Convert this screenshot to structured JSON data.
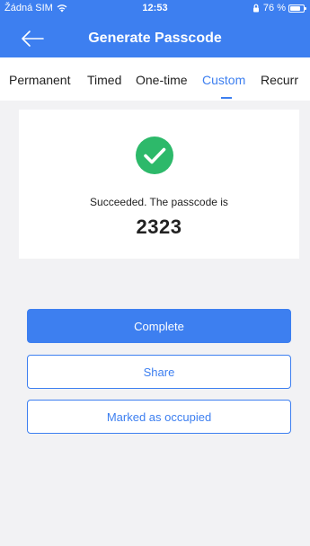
{
  "status_bar": {
    "carrier": "Žádná SIM",
    "time": "12:53",
    "battery": "76 %"
  },
  "nav": {
    "title": "Generate Passcode",
    "back_icon": "arrow-left-icon"
  },
  "tabs": [
    {
      "label": "Permanent",
      "active": false
    },
    {
      "label": "Timed",
      "active": false
    },
    {
      "label": "One-time",
      "active": false
    },
    {
      "label": "Custom",
      "active": true
    },
    {
      "label": "Recurr",
      "active": false
    }
  ],
  "result": {
    "icon": "check-circle-icon",
    "message": "Succeeded. The passcode is",
    "passcode": "2323"
  },
  "actions": {
    "complete_label": "Complete",
    "share_label": "Share",
    "occupied_label": "Marked as occupied"
  },
  "colors": {
    "accent": "#3d7ff0",
    "success": "#2db96a",
    "background": "#f2f2f4"
  }
}
